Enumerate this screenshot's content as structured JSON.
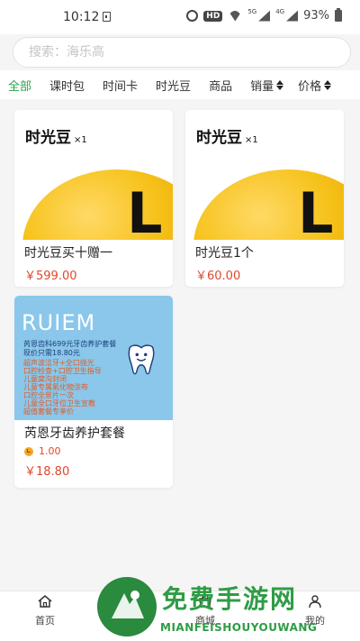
{
  "status_bar": {
    "time": "10:12",
    "hd_label": "HD",
    "net_5g": "5G",
    "net_4g": "4G",
    "battery": "93%"
  },
  "search": {
    "placeholder": "搜索：海乐高"
  },
  "tabs": [
    {
      "label": "全部",
      "active": true
    },
    {
      "label": "课时包"
    },
    {
      "label": "时间卡"
    },
    {
      "label": "时光豆"
    },
    {
      "label": "商品"
    },
    {
      "label": "销量",
      "sortable": true
    },
    {
      "label": "价格",
      "sortable": true
    }
  ],
  "products": [
    {
      "image_title": "时光豆",
      "image_multiplier": "×1",
      "image_letter": "L",
      "name": "时光豆买十赠一",
      "price": "￥599.00"
    },
    {
      "image_title": "时光豆",
      "image_multiplier": "×1",
      "image_letter": "L",
      "name": "时光豆1个",
      "price": "￥60.00"
    },
    {
      "image_brand": "RUIEM",
      "image_lines": [
        "芮恩齿科699元牙齿养护套餐",
        "现价只需18.80元",
        "超声波洁牙+全口抛光",
        "口腔检查+口腔卫生指导",
        "儿童窝沟封闭",
        "儿童专属氟化物涂布",
        "口腔全景片一次",
        "儿童全口牙位卫生宣教",
        "超值套餐专享价"
      ],
      "name": "芮恩牙齿养护套餐",
      "coins": "1.00",
      "price": "￥18.80"
    }
  ],
  "bottom_nav": [
    {
      "label": "首页",
      "icon": "home-icon"
    },
    {
      "label": "商城",
      "icon": "shop-icon"
    },
    {
      "label": "我的",
      "icon": "user-icon"
    }
  ],
  "watermark": {
    "title": "免费手游网",
    "subtitle": "MIANFEISHOUYOUWANG"
  },
  "colors": {
    "accent": "#2aa44a",
    "price": "#e0472b",
    "bean": "#f6c21a",
    "dental_bg": "#8ac7ea"
  }
}
